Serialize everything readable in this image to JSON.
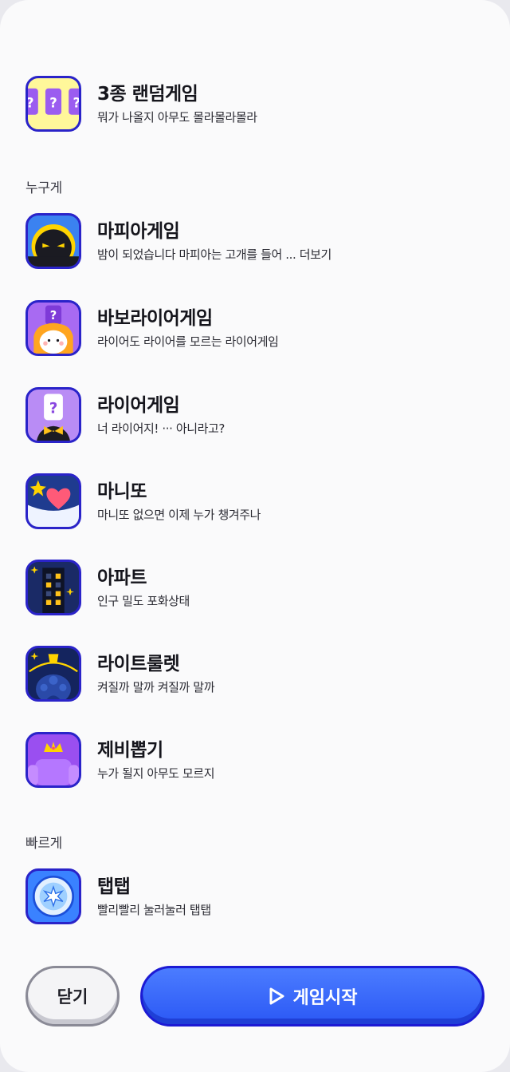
{
  "sections": {
    "who": "누구게",
    "fast": "빠르게"
  },
  "games": [
    {
      "title": "3종 랜덤게임",
      "desc": "뭐가 나올지 아무도 몰라몰라몰라"
    },
    {
      "title": "마피아게임",
      "desc": "밤이 되었습니다 마피아는 고개를 들어 ... 더보기"
    },
    {
      "title": "바보라이어게임",
      "desc": "라이어도 라이어를 모르는 라이어게임"
    },
    {
      "title": "라이어게임",
      "desc": "너 라이어지! ··· 아니라고?"
    },
    {
      "title": "마니또",
      "desc": "마니또 없으면 이제 누가 챙겨주나"
    },
    {
      "title": "아파트",
      "desc": "인구 밀도 포화상태"
    },
    {
      "title": "라이트룰렛",
      "desc": "켜질까 말까 켜질까 말까"
    },
    {
      "title": "제비뽑기",
      "desc": "누가 될지 아무도 모르지"
    },
    {
      "title": "탭탭",
      "desc": "빨리빨리 눌러눌러 탭탭"
    }
  ],
  "buttons": {
    "close": "닫기",
    "start": "게임시작"
  },
  "colors": {
    "accent": "#2b58f5",
    "icon_border": "#2a23c9"
  }
}
